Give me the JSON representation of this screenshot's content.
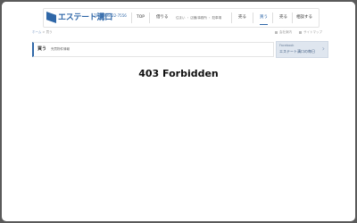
{
  "header": {
    "logo_text": "エステート溝口",
    "logo_phone": "TEL 0798-22-7556",
    "nav": {
      "top": "TOP",
      "rent": "借りる",
      "rent_sub": "住まい ・ 店舗/事務所 ・ 駐車場",
      "buy": "買う",
      "sell": "売る",
      "consult": "相談する"
    }
  },
  "breadcrumbs": {
    "home": "ホーム",
    "sep": ">",
    "current": "買う"
  },
  "util_links": {
    "link1": "会社案内",
    "link2": "サイトマップ"
  },
  "title_band": {
    "main": "買う",
    "sub": "売買物件情報"
  },
  "facebook_banner": {
    "line1": "Facebook",
    "line2": "エステート溝口の毎日"
  },
  "main": {
    "error": "403 Forbidden"
  }
}
